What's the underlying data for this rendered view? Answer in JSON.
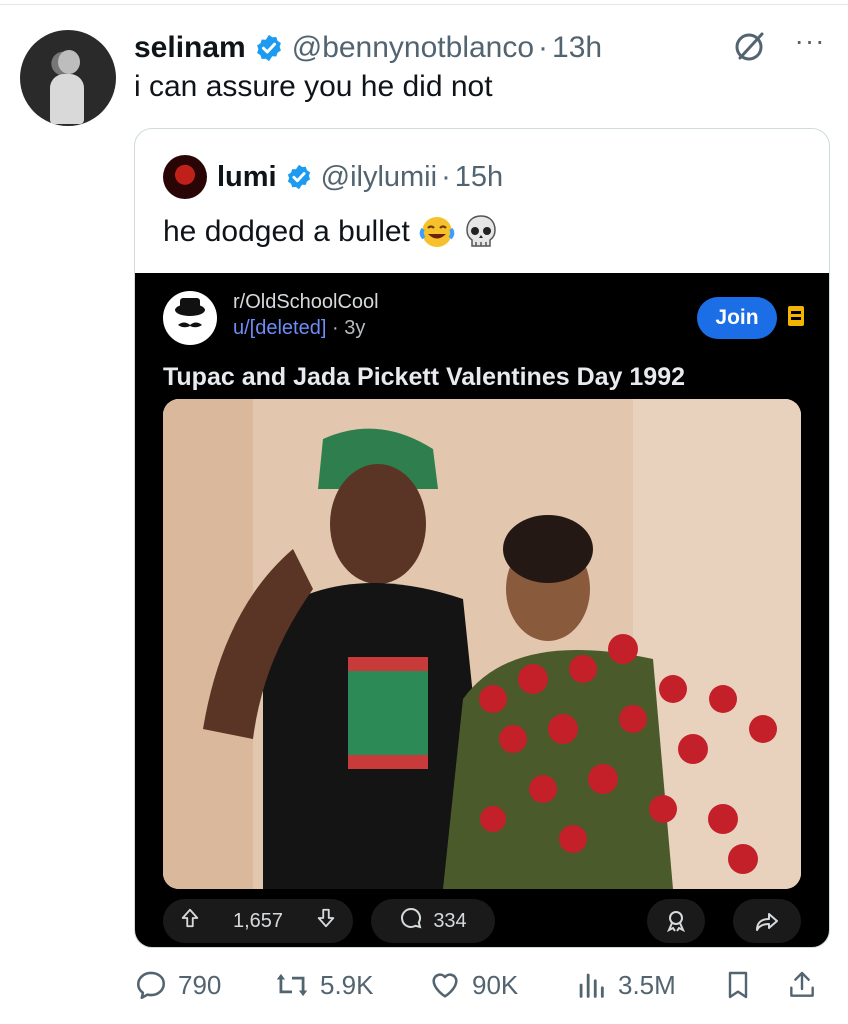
{
  "tweet": {
    "author_name": "selinam",
    "handle": "@bennynotblanco",
    "separator": "·",
    "time": "13h",
    "text": "i can assure you he did not",
    "more_label": "···"
  },
  "quote": {
    "author_name": "lumi",
    "handle": "@ilylumii",
    "separator": "·",
    "time": "15h",
    "text": "he dodged a bullet",
    "emojis": [
      "face-with-tears-of-joy",
      "skull"
    ]
  },
  "reddit": {
    "subreddit": "r/OldSchoolCool",
    "user": "u/[deleted]",
    "separator": "·",
    "age": "3y",
    "join_label": "Join",
    "title": "Tupac and Jada Pickett Valentines Day 1992",
    "upvotes": "1,657",
    "comments": "334"
  },
  "actions": {
    "replies": "790",
    "retweets": "5.9K",
    "likes": "90K",
    "views": "3.5M"
  },
  "colors": {
    "text": "#0f1419",
    "muted": "#536471",
    "verified": "#1d9bf0",
    "reddit_join": "#1b6ee6",
    "reddit_bg": "#000000"
  },
  "icons": [
    "verified-badge-icon",
    "grok-icon",
    "more-icon",
    "reply-icon",
    "retweet-icon",
    "like-icon",
    "views-icon",
    "bookmark-icon",
    "share-icon",
    "upvote-icon",
    "downvote-icon",
    "comment-icon",
    "award-icon",
    "reddit-share-icon",
    "reddit-menu-icon"
  ]
}
